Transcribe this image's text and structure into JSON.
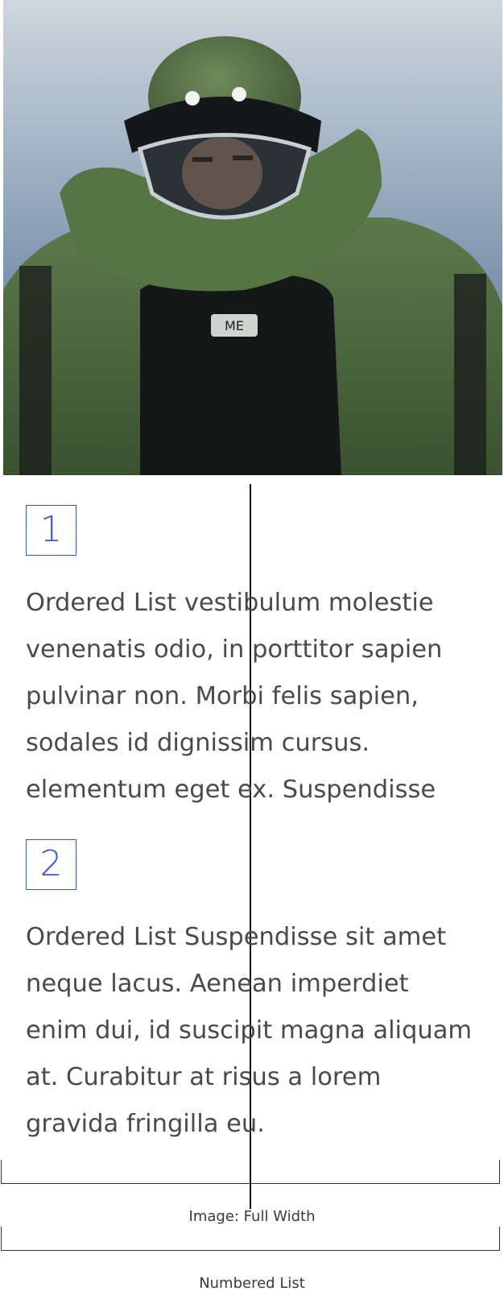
{
  "hero_image": {
    "alt": "Person in green bomb disposal suit and helmet"
  },
  "list": {
    "items": [
      {
        "number": "1",
        "text": "Ordered List vestibulum molestie venenatis odio, in porttitor sapien pulvinar non. Morbi felis sapien, sodales id dignissim cursus. elementum eget ex. Suspendisse"
      },
      {
        "number": "2",
        "text": "Ordered List Suspendisse sit amet neque lacus. Aenean imperdiet enim dui, id suscipit magna aliquam at. Curabitur at risus a lorem gravida fringilla eu."
      }
    ]
  },
  "annotations": {
    "image_label": "Image: Full Width",
    "list_label": "Numbered List"
  },
  "colors": {
    "accent": "#3b57c9",
    "text": "#4a4a4a",
    "suit_green": "#4d6a3f"
  }
}
